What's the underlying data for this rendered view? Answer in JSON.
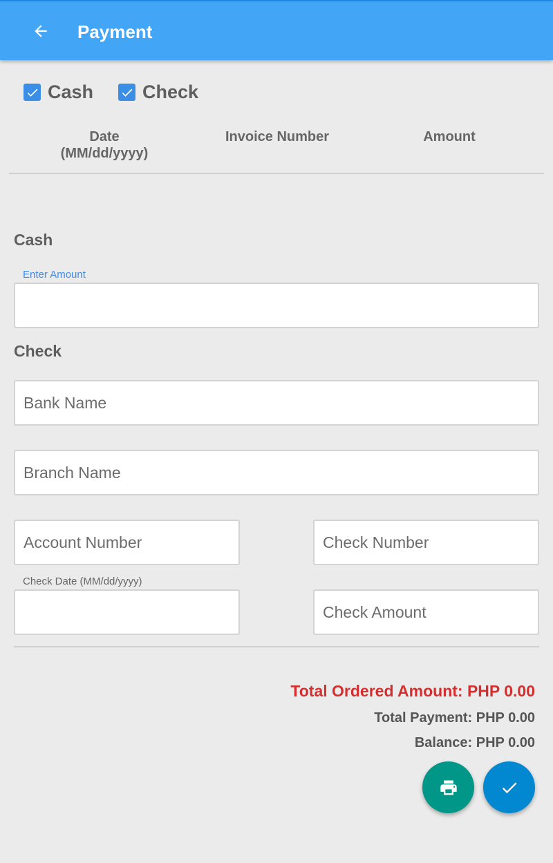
{
  "app_bar": {
    "title": "Payment",
    "back_icon": "arrow-back-icon",
    "color": "#42a5f5"
  },
  "payment_types": [
    {
      "label": "Cash",
      "checked": true
    },
    {
      "label": "Check",
      "checked": true
    }
  ],
  "invoice_table": {
    "columns": [
      "Date\n(MM/dd/yyyy)",
      "Invoice Number",
      "Amount"
    ],
    "rows": []
  },
  "cash_section": {
    "title": "Cash",
    "amount_label": "Enter Amount",
    "amount_value": ""
  },
  "check_section": {
    "title": "Check",
    "bank_name_placeholder": "Bank Name",
    "branch_name_placeholder": "Branch Name",
    "account_number_placeholder": "Account Number",
    "check_number_placeholder": "Check Number",
    "check_date_label": "Check Date (MM/dd/yyyy)",
    "check_date_value": "",
    "check_amount_placeholder": "Check Amount"
  },
  "totals": {
    "total_ordered": "Total Ordered Amount: PHP 0.00",
    "total_payment": "Total Payment: PHP 0.00",
    "balance": "Balance: PHP 0.00",
    "ordered_color": "#d32f2f"
  },
  "actions": {
    "print_icon": "print-icon",
    "print_color": "#009688",
    "confirm_icon": "check-icon",
    "confirm_color": "#0288d1"
  }
}
